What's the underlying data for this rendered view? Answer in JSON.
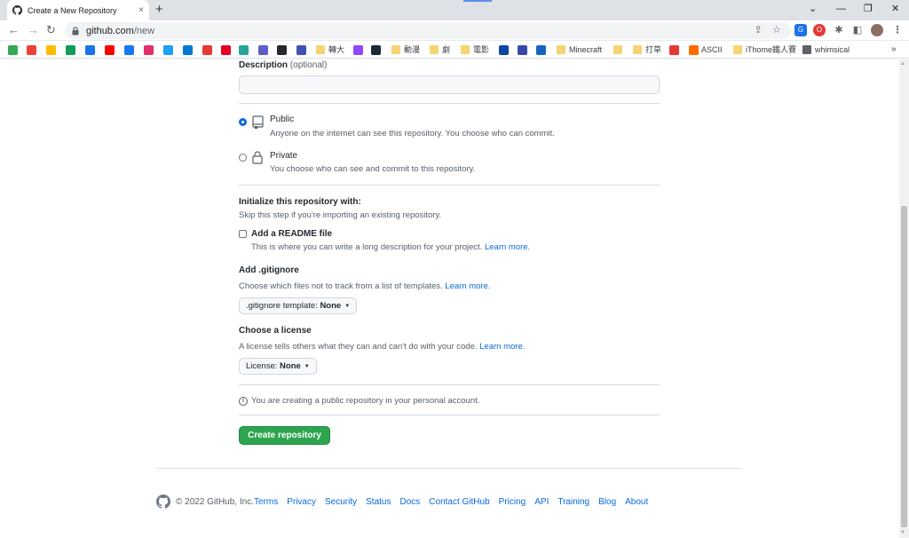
{
  "browser": {
    "tab_title": "Create a New Repository",
    "tab_close": "×",
    "new_tab": "+",
    "window_controls": [
      "⌄",
      "—",
      "❐",
      "✕"
    ],
    "url_host": "github.com",
    "url_path": "/new",
    "nav": {
      "back": "←",
      "forward": "→",
      "reload": "↻"
    },
    "bookmarks": [
      {
        "label": "",
        "color": "#34a853"
      },
      {
        "label": "",
        "color": "#ea4335"
      },
      {
        "label": "",
        "color": "#fbbc04"
      },
      {
        "label": "",
        "color": "#0f9d58"
      },
      {
        "label": "",
        "color": "#1a73e8"
      },
      {
        "label": "",
        "color": "#ff0000"
      },
      {
        "label": "",
        "color": "#1877f2"
      },
      {
        "label": "",
        "color": "#e1306c"
      },
      {
        "label": "",
        "color": "#1da1f2"
      },
      {
        "label": "",
        "color": "#0078d4"
      },
      {
        "label": "",
        "color": "#e53935"
      },
      {
        "label": "",
        "color": "#e60023"
      },
      {
        "label": "",
        "color": "#26a69a"
      },
      {
        "label": "",
        "color": "#5b5fc7"
      },
      {
        "label": "",
        "color": "#24292f"
      },
      {
        "label": "",
        "color": "#3f51b5"
      },
      {
        "label": "轉大",
        "color": "#f6d474"
      },
      {
        "label": "",
        "color": "#9146ff"
      },
      {
        "label": "",
        "color": "#1b2838"
      },
      {
        "label": "動漫",
        "color": "#f6d474"
      },
      {
        "label": "劇",
        "color": "#f6d474"
      },
      {
        "label": "電影",
        "color": "#f6d474"
      },
      {
        "label": "",
        "color": "#0d47a1"
      },
      {
        "label": "",
        "color": "#3949ab"
      },
      {
        "label": "",
        "color": "#1565c0"
      },
      {
        "label": "Minecraft",
        "color": "#f6d474"
      },
      {
        "label": "",
        "color": "#f6d474"
      },
      {
        "label": "打草",
        "color": "#f6d474"
      },
      {
        "label": "",
        "color": "#e53935"
      },
      {
        "label": "ASCII",
        "color": "#ff6d00"
      },
      {
        "label": "iThome鐵人賽",
        "color": "#f6d474"
      },
      {
        "label": "whimsical",
        "color": "#5f6368"
      }
    ],
    "more_bookmarks": "»"
  },
  "form": {
    "description_label": "Description",
    "description_optional": "(optional)",
    "description_value": "",
    "public_title": "Public",
    "public_desc": "Anyone on the internet can see this repository. You choose who can commit.",
    "private_title": "Private",
    "private_desc": "You choose who can see and commit to this repository.",
    "init_title": "Initialize this repository with:",
    "init_desc": "Skip this step if you're importing an existing repository.",
    "readme_label": "Add a README file",
    "readme_desc": "This is where you can write a long description for your project.",
    "readme_link": "Learn more.",
    "gitignore_title": "Add .gitignore",
    "gitignore_desc": "Choose which files not to track from a list of templates.",
    "gitignore_link": "Learn more.",
    "gitignore_select_prefix": ".gitignore template:",
    "gitignore_select_value": "None",
    "license_title": "Choose a license",
    "license_desc": "A license tells others what they can and can't do with your code.",
    "license_link": "Learn more.",
    "license_select_prefix": "License:",
    "license_select_value": "None",
    "info_text": "You are creating a public repository in your personal account.",
    "create_button": "Create repository"
  },
  "footer": {
    "copyright": "© 2022 GitHub, Inc.",
    "links": [
      "Terms",
      "Privacy",
      "Security",
      "Status",
      "Docs",
      "Contact GitHub",
      "Pricing",
      "API",
      "Training",
      "Blog",
      "About"
    ]
  },
  "colors": {
    "accent": "#0969da",
    "primary_button": "#2da44e"
  }
}
